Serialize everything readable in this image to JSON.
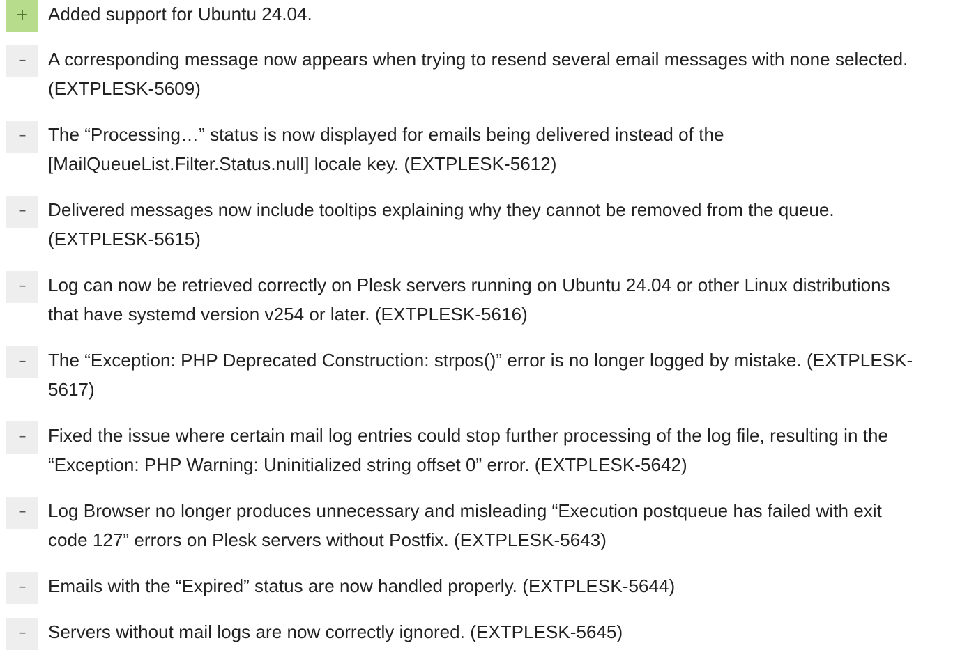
{
  "colors": {
    "added_badge": "#b7dd8c",
    "fixed_badge": "#eeeeee",
    "text": "#222222"
  },
  "entries": [
    {
      "type": "added",
      "symbol": "+",
      "lines": [
        "Added support for Ubuntu 24.04."
      ]
    },
    {
      "type": "fixed",
      "symbol": "–",
      "lines": [
        "A corresponding message now appears when trying to resend several email messages with none selected.",
        "(EXTPLESK-5609)"
      ]
    },
    {
      "type": "fixed",
      "symbol": "–",
      "lines": [
        "The “Processing…” status is now displayed for emails being delivered instead of the",
        "[MailQueueList.Filter.Status.null] locale key. (EXTPLESK-5612)"
      ]
    },
    {
      "type": "fixed",
      "symbol": "–",
      "lines": [
        "Delivered messages now include tooltips explaining why they cannot be removed from the queue.",
        "(EXTPLESK-5615)"
      ]
    },
    {
      "type": "fixed",
      "symbol": "–",
      "lines": [
        "Log can now be retrieved correctly on Plesk servers running on Ubuntu 24.04 or other Linux distributions",
        "that have systemd version v254 or later. (EXTPLESK-5616)"
      ]
    },
    {
      "type": "fixed",
      "symbol": "–",
      "lines": [
        "The “Exception: PHP Deprecated Construction: strpos()” error is no longer logged by mistake. (EXTPLESK-",
        "5617)"
      ]
    },
    {
      "type": "fixed",
      "symbol": "–",
      "lines": [
        "Fixed the issue where certain mail log entries could stop further processing of the log file, resulting in the",
        "“Exception: PHP Warning: Uninitialized string offset 0” error. (EXTPLESK-5642)"
      ]
    },
    {
      "type": "fixed",
      "symbol": "–",
      "lines": [
        "Log Browser no longer produces unnecessary and misleading “Execution postqueue has failed with exit",
        "code 127” errors on Plesk servers without Postfix. (EXTPLESK-5643)"
      ]
    },
    {
      "type": "fixed",
      "symbol": "–",
      "lines": [
        "Emails with the “Expired” status are now handled properly. (EXTPLESK-5644)"
      ]
    },
    {
      "type": "fixed",
      "symbol": "–",
      "lines": [
        "Servers without mail logs are now correctly ignored. (EXTPLESK-5645)"
      ]
    }
  ]
}
